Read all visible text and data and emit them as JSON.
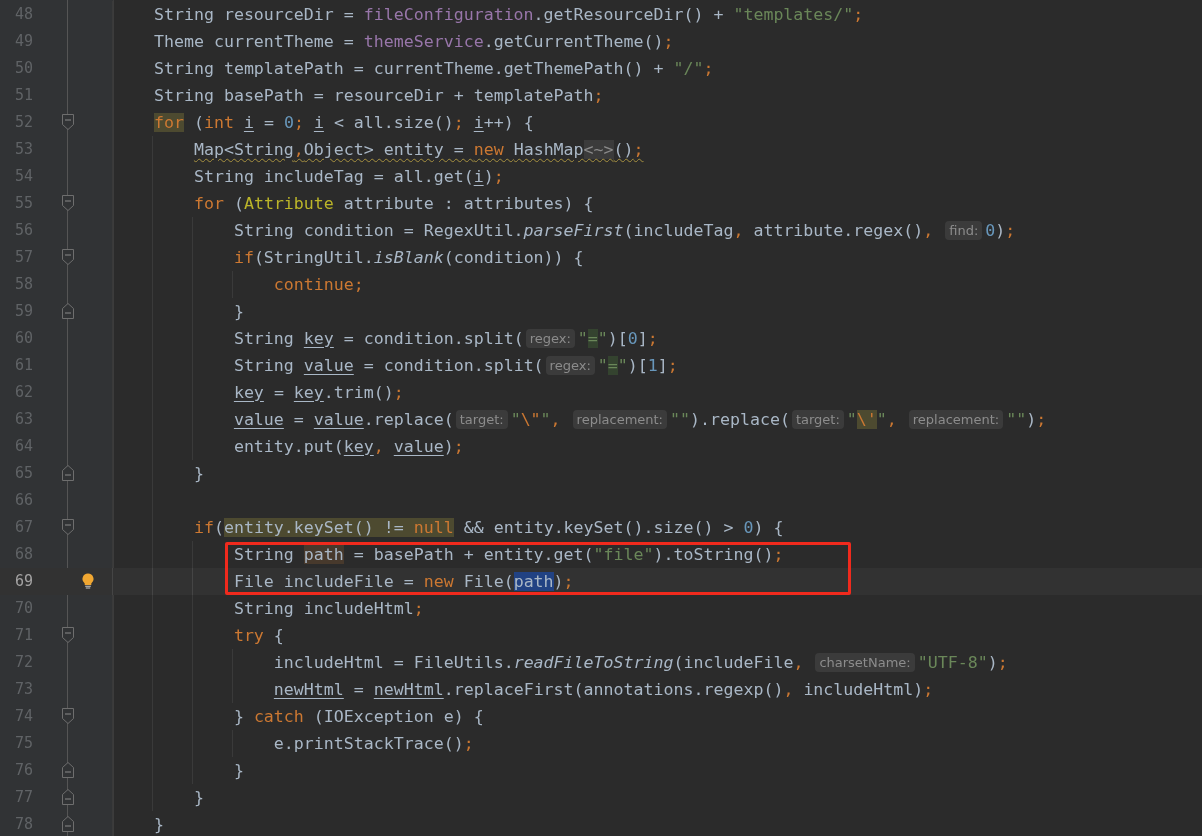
{
  "lines": [
    {
      "number": "48",
      "fold_open": false,
      "fold_close": false,
      "current": false,
      "boxed": false,
      "bulb": false,
      "tokens": [
        {
          "t": "    String resourceDir = ",
          "kind": "plain"
        },
        {
          "t": "fileConfiguration",
          "kind": "field"
        },
        {
          "t": ".getResourceDir() + ",
          "kind": "plain"
        },
        {
          "t": "\"templates/\"",
          "kind": "string"
        },
        {
          "t": ";",
          "kind": "keyword"
        }
      ]
    },
    {
      "number": "49",
      "fold_open": false,
      "fold_close": false,
      "current": false,
      "boxed": false,
      "bulb": false,
      "tokens": [
        {
          "t": "    Theme currentTheme = ",
          "kind": "plain"
        },
        {
          "t": "themeService",
          "kind": "field"
        },
        {
          "t": ".getCurrentTheme()",
          "kind": "plain"
        },
        {
          "t": ";",
          "kind": "keyword"
        }
      ]
    },
    {
      "number": "50",
      "fold_open": false,
      "fold_close": false,
      "current": false,
      "boxed": false,
      "bulb": false,
      "tokens": [
        {
          "t": "    String templatePath = currentTheme.getThemePath() + ",
          "kind": "plain"
        },
        {
          "t": "\"/\"",
          "kind": "string"
        },
        {
          "t": ";",
          "kind": "keyword"
        }
      ]
    },
    {
      "number": "51",
      "fold_open": false,
      "fold_close": false,
      "current": false,
      "boxed": false,
      "bulb": false,
      "tokens": [
        {
          "t": "    String basePath = resourceDir + templatePath",
          "kind": "plain"
        },
        {
          "t": ";",
          "kind": "keyword"
        }
      ]
    },
    {
      "number": "52",
      "fold_open": true,
      "fold_close": false,
      "current": false,
      "boxed": false,
      "bulb": false,
      "tokens": [
        {
          "t": "    for",
          "kind": "keyword_warn"
        },
        {
          "t": " (",
          "kind": "plain"
        },
        {
          "t": "int ",
          "kind": "keyword"
        },
        {
          "t": "i",
          "kind": "var"
        },
        {
          "t": " = ",
          "kind": "plain"
        },
        {
          "t": "0",
          "kind": "number"
        },
        {
          "t": "; ",
          "kind": "keyword"
        },
        {
          "t": "i",
          "kind": "var"
        },
        {
          "t": " < all.size()",
          "kind": "plain"
        },
        {
          "t": "; ",
          "kind": "keyword"
        },
        {
          "t": "i",
          "kind": "var"
        },
        {
          "t": "++) {",
          "kind": "plain"
        }
      ]
    },
    {
      "number": "53",
      "fold_open": false,
      "fold_close": false,
      "current": false,
      "boxed": false,
      "bulb": false,
      "tokens": [
        {
          "t": "        Map<String",
          "kind": "plain_wavy"
        },
        {
          "t": ",",
          "kind": "keyword_wavy"
        },
        {
          "t": "Object> entity = ",
          "kind": "plain_wavy"
        },
        {
          "t": "new ",
          "kind": "keyword_wavy"
        },
        {
          "t": "HashMap",
          "kind": "plain_wavy"
        },
        {
          "t": "<~>",
          "kind": "folded_wavy"
        },
        {
          "t": "()",
          "kind": "plain_wavy"
        },
        {
          "t": ";",
          "kind": "keyword_wavy"
        }
      ]
    },
    {
      "number": "54",
      "fold_open": false,
      "fold_close": false,
      "current": false,
      "boxed": false,
      "bulb": false,
      "tokens": [
        {
          "t": "        String includeTag = all.get(",
          "kind": "plain"
        },
        {
          "t": "i",
          "kind": "var"
        },
        {
          "t": ")",
          "kind": "plain"
        },
        {
          "t": ";",
          "kind": "keyword"
        }
      ]
    },
    {
      "number": "55",
      "fold_open": true,
      "fold_close": false,
      "current": false,
      "boxed": false,
      "bulb": false,
      "tokens": [
        {
          "t": "        for ",
          "kind": "keyword"
        },
        {
          "t": "(",
          "kind": "plain"
        },
        {
          "t": "Attribute",
          "kind": "class"
        },
        {
          "t": " attribute : attributes) {",
          "kind": "plain"
        }
      ]
    },
    {
      "number": "56",
      "fold_open": false,
      "fold_close": false,
      "current": false,
      "boxed": false,
      "bulb": false,
      "tokens": [
        {
          "t": "            String condition = RegexUtil.",
          "kind": "plain"
        },
        {
          "t": "parseFirst",
          "kind": "static"
        },
        {
          "t": "(includeTag",
          "kind": "plain"
        },
        {
          "t": ", ",
          "kind": "keyword"
        },
        {
          "t": "attribute.regex()",
          "kind": "plain"
        },
        {
          "t": ", ",
          "kind": "keyword"
        },
        {
          "t": "find:",
          "kind": "hint"
        },
        {
          "t": "0",
          "kind": "number"
        },
        {
          "t": ")",
          "kind": "plain"
        },
        {
          "t": ";",
          "kind": "keyword"
        }
      ]
    },
    {
      "number": "57",
      "fold_open": true,
      "fold_close": false,
      "current": false,
      "boxed": false,
      "bulb": false,
      "tokens": [
        {
          "t": "            if",
          "kind": "keyword"
        },
        {
          "t": "(StringUtil.",
          "kind": "plain"
        },
        {
          "t": "isBlank",
          "kind": "static"
        },
        {
          "t": "(condition)) {",
          "kind": "plain"
        }
      ]
    },
    {
      "number": "58",
      "fold_open": false,
      "fold_close": false,
      "current": false,
      "boxed": false,
      "bulb": false,
      "tokens": [
        {
          "t": "                continue",
          "kind": "keyword"
        },
        {
          "t": ";",
          "kind": "keyword"
        }
      ]
    },
    {
      "number": "59",
      "fold_open": false,
      "fold_close": true,
      "current": false,
      "boxed": false,
      "bulb": false,
      "tokens": [
        {
          "t": "            }",
          "kind": "plain"
        }
      ]
    },
    {
      "number": "60",
      "fold_open": false,
      "fold_close": false,
      "current": false,
      "boxed": false,
      "bulb": false,
      "tokens": [
        {
          "t": "            String ",
          "kind": "plain"
        },
        {
          "t": "key",
          "kind": "var"
        },
        {
          "t": " = condition.split(",
          "kind": "plain"
        },
        {
          "t": "regex:",
          "kind": "hint"
        },
        {
          "t": "\"",
          "kind": "string"
        },
        {
          "t": "=",
          "kind": "match"
        },
        {
          "t": "\"",
          "kind": "string"
        },
        {
          "t": ")[",
          "kind": "plain"
        },
        {
          "t": "0",
          "kind": "number"
        },
        {
          "t": "]",
          "kind": "plain"
        },
        {
          "t": ";",
          "kind": "keyword"
        }
      ]
    },
    {
      "number": "61",
      "fold_open": false,
      "fold_close": false,
      "current": false,
      "boxed": false,
      "bulb": false,
      "tokens": [
        {
          "t": "            String ",
          "kind": "plain"
        },
        {
          "t": "value",
          "kind": "var"
        },
        {
          "t": " = condition.split(",
          "kind": "plain"
        },
        {
          "t": "regex:",
          "kind": "hint"
        },
        {
          "t": "\"",
          "kind": "string"
        },
        {
          "t": "=",
          "kind": "match"
        },
        {
          "t": "\"",
          "kind": "string"
        },
        {
          "t": ")[",
          "kind": "plain"
        },
        {
          "t": "1",
          "kind": "number"
        },
        {
          "t": "]",
          "kind": "plain"
        },
        {
          "t": ";",
          "kind": "keyword"
        }
      ]
    },
    {
      "number": "62",
      "fold_open": false,
      "fold_close": false,
      "current": false,
      "boxed": false,
      "bulb": false,
      "tokens": [
        {
          "t": "            key",
          "kind": "var"
        },
        {
          "t": " = ",
          "kind": "plain"
        },
        {
          "t": "key",
          "kind": "var"
        },
        {
          "t": ".trim()",
          "kind": "plain"
        },
        {
          "t": ";",
          "kind": "keyword"
        }
      ]
    },
    {
      "number": "63",
      "fold_open": false,
      "fold_close": false,
      "current": false,
      "boxed": false,
      "bulb": false,
      "tokens": [
        {
          "t": "            value",
          "kind": "var"
        },
        {
          "t": " = ",
          "kind": "plain"
        },
        {
          "t": "value",
          "kind": "var"
        },
        {
          "t": ".replace(",
          "kind": "plain"
        },
        {
          "t": "target:",
          "kind": "hint"
        },
        {
          "t": "\"",
          "kind": "string"
        },
        {
          "t": "\\\"",
          "kind": "keyword"
        },
        {
          "t": "\"",
          "kind": "string"
        },
        {
          "t": ", ",
          "kind": "keyword"
        },
        {
          "t": "replacement:",
          "kind": "hint"
        },
        {
          "t": "\"\"",
          "kind": "string"
        },
        {
          "t": ").replace(",
          "kind": "plain"
        },
        {
          "t": "target:",
          "kind": "hint"
        },
        {
          "t": "\"",
          "kind": "string"
        },
        {
          "t": "\\'",
          "kind": "keyword_warn"
        },
        {
          "t": "\"",
          "kind": "string"
        },
        {
          "t": ", ",
          "kind": "keyword"
        },
        {
          "t": "replacement:",
          "kind": "hint"
        },
        {
          "t": "\"\"",
          "kind": "string"
        },
        {
          "t": ")",
          "kind": "plain"
        },
        {
          "t": ";",
          "kind": "keyword"
        }
      ]
    },
    {
      "number": "64",
      "fold_open": false,
      "fold_close": false,
      "current": false,
      "boxed": false,
      "bulb": false,
      "tokens": [
        {
          "t": "            entity.put(",
          "kind": "plain"
        },
        {
          "t": "key",
          "kind": "var"
        },
        {
          "t": ", ",
          "kind": "keyword"
        },
        {
          "t": "value",
          "kind": "var"
        },
        {
          "t": ")",
          "kind": "plain"
        },
        {
          "t": ";",
          "kind": "keyword"
        }
      ]
    },
    {
      "number": "65",
      "fold_open": false,
      "fold_close": true,
      "current": false,
      "boxed": false,
      "bulb": false,
      "tokens": [
        {
          "t": "        }",
          "kind": "plain"
        }
      ]
    },
    {
      "number": "66",
      "fold_open": false,
      "fold_close": false,
      "current": false,
      "boxed": false,
      "bulb": false
    },
    {
      "number": "67",
      "fold_open": true,
      "fold_close": false,
      "current": false,
      "boxed": false,
      "bulb": false,
      "tokens": [
        {
          "t": "        if",
          "kind": "keyword"
        },
        {
          "t": "(",
          "kind": "plain"
        },
        {
          "t": "entity.keySet() != ",
          "kind": "plain_warn"
        },
        {
          "t": "null",
          "kind": "keyword_warn"
        },
        {
          "t": " && entity.keySet().size() > ",
          "kind": "plain"
        },
        {
          "t": "0",
          "kind": "number"
        },
        {
          "t": ") {",
          "kind": "plain"
        }
      ]
    },
    {
      "number": "68",
      "fold_open": false,
      "fold_close": false,
      "current": false,
      "boxed": true,
      "bulb": false,
      "tokens": [
        {
          "t": "            String ",
          "kind": "plain"
        },
        {
          "t": "path",
          "kind": "write"
        },
        {
          "t": " = basePath + entity.get(",
          "kind": "plain"
        },
        {
          "t": "\"file\"",
          "kind": "string"
        },
        {
          "t": ").toString()",
          "kind": "plain"
        },
        {
          "t": ";",
          "kind": "keyword"
        }
      ]
    },
    {
      "number": "69",
      "fold_open": false,
      "fold_close": false,
      "current": true,
      "boxed": true,
      "bulb": true,
      "tokens": [
        {
          "t": "            File includeFile = ",
          "kind": "plain"
        },
        {
          "t": "new ",
          "kind": "keyword"
        },
        {
          "t": "File(",
          "kind": "plain"
        },
        {
          "t": "path",
          "kind": "read"
        },
        {
          "t": ")",
          "kind": "plain"
        },
        {
          "t": ";",
          "kind": "keyword"
        }
      ]
    },
    {
      "number": "70",
      "fold_open": false,
      "fold_close": false,
      "current": false,
      "boxed": false,
      "bulb": false,
      "tokens": [
        {
          "t": "            String includeHtml",
          "kind": "plain"
        },
        {
          "t": ";",
          "kind": "keyword"
        }
      ]
    },
    {
      "number": "71",
      "fold_open": true,
      "fold_close": false,
      "current": false,
      "boxed": false,
      "bulb": false,
      "tokens": [
        {
          "t": "            try ",
          "kind": "keyword"
        },
        {
          "t": "{",
          "kind": "plain"
        }
      ]
    },
    {
      "number": "72",
      "fold_open": false,
      "fold_close": false,
      "current": false,
      "boxed": false,
      "bulb": false,
      "tokens": [
        {
          "t": "                includeHtml = FileUtils.",
          "kind": "plain"
        },
        {
          "t": "readFileToString",
          "kind": "static"
        },
        {
          "t": "(includeFile",
          "kind": "plain"
        },
        {
          "t": ", ",
          "kind": "keyword"
        },
        {
          "t": "charsetName:",
          "kind": "hint"
        },
        {
          "t": "\"UTF-8\"",
          "kind": "string"
        },
        {
          "t": ")",
          "kind": "plain"
        },
        {
          "t": ";",
          "kind": "keyword"
        }
      ]
    },
    {
      "number": "73",
      "fold_open": false,
      "fold_close": false,
      "current": false,
      "boxed": false,
      "bulb": false,
      "tokens": [
        {
          "t": "                newHtml",
          "kind": "var"
        },
        {
          "t": " = ",
          "kind": "plain"
        },
        {
          "t": "newHtml",
          "kind": "var"
        },
        {
          "t": ".replaceFirst(annotations.regexp()",
          "kind": "plain"
        },
        {
          "t": ", ",
          "kind": "keyword"
        },
        {
          "t": "includeHtml)",
          "kind": "plain"
        },
        {
          "t": ";",
          "kind": "keyword"
        }
      ]
    },
    {
      "number": "74",
      "fold_open": true,
      "fold_close": false,
      "current": false,
      "boxed": false,
      "bulb": false,
      "tokens": [
        {
          "t": "            } ",
          "kind": "plain"
        },
        {
          "t": "catch ",
          "kind": "keyword"
        },
        {
          "t": "(IOException e) {",
          "kind": "plain"
        }
      ]
    },
    {
      "number": "75",
      "fold_open": false,
      "fold_close": false,
      "current": false,
      "boxed": false,
      "bulb": false,
      "tokens": [
        {
          "t": "                e.printStackTrace()",
          "kind": "plain"
        },
        {
          "t": ";",
          "kind": "keyword"
        }
      ]
    },
    {
      "number": "76",
      "fold_open": false,
      "fold_close": true,
      "current": false,
      "boxed": false,
      "bulb": false,
      "tokens": [
        {
          "t": "            }",
          "kind": "plain"
        }
      ]
    },
    {
      "number": "77",
      "fold_open": false,
      "fold_close": true,
      "current": false,
      "boxed": false,
      "bulb": false,
      "tokens": [
        {
          "t": "        }",
          "kind": "plain"
        }
      ]
    },
    {
      "number": "78",
      "fold_open": false,
      "fold_close": true,
      "current": false,
      "boxed": false,
      "bulb": false,
      "tokens": [
        {
          "t": "    }",
          "kind": "plain"
        }
      ]
    }
  ]
}
